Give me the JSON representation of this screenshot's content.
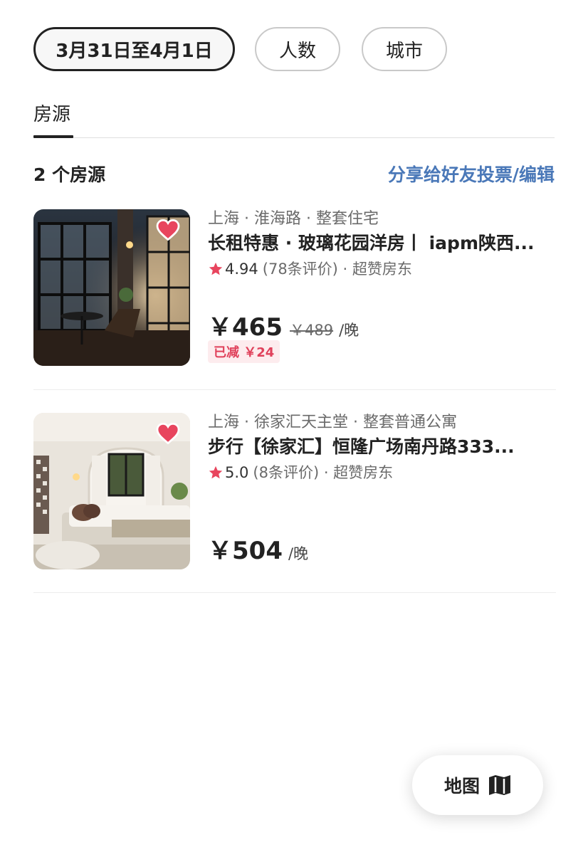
{
  "filters": {
    "dates": "3月31日至4月1日",
    "guests": "人数",
    "city": "城市"
  },
  "tabs": {
    "listings": "房源"
  },
  "summary": {
    "count": "2 个房源",
    "share": "分享给好友投票/编辑"
  },
  "listings": [
    {
      "location": "上海 · 淮海路 · 整套住宅",
      "title": "长租特惠 · 玻璃花园洋房丨 iapm陕西...",
      "score": "4.94",
      "reviews": "(78条评价) · 超赞房东",
      "price": "￥465",
      "original_price": "￥489",
      "per": "/晚",
      "discount": "已减 ￥24",
      "favorited": true
    },
    {
      "location": "上海 · 徐家汇天主堂 · 整套普通公寓",
      "title": "步行【徐家汇】恒隆广场南丹路333...",
      "score": "5.0",
      "reviews": "(8条评价) · 超赞房东",
      "price": "￥504",
      "per": "/晚",
      "favorited": true
    }
  ],
  "map_button": {
    "label": "地图",
    "icon": "map-icon"
  },
  "colors": {
    "accent_link": "#4a78b8",
    "heart": "#e8455e",
    "star": "#e8455e",
    "discount_text": "#e0415b",
    "discount_bg": "#fdecee"
  }
}
